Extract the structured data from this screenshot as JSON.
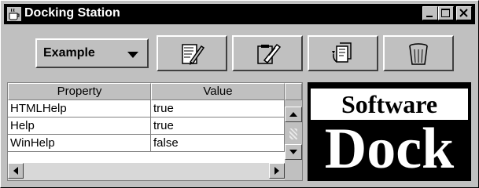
{
  "window": {
    "title": "Docking Station"
  },
  "titlebar_buttons": [
    "minimize",
    "maximize",
    "close"
  ],
  "toolbar": {
    "combo_value": "Example",
    "buttons": [
      {
        "icon": "edit-document-icon"
      },
      {
        "icon": "paste-clipboard-icon"
      },
      {
        "icon": "refresh-copy-icon"
      },
      {
        "icon": "trash-can-icon"
      }
    ]
  },
  "table": {
    "columns": [
      "Property",
      "Value"
    ],
    "rows": [
      {
        "property": "HTMLHelp",
        "value": "true"
      },
      {
        "property": "Help",
        "value": "true"
      },
      {
        "property": "WinHelp",
        "value": "false"
      }
    ]
  },
  "logo": {
    "line1": "Software",
    "line2": "Dock"
  }
}
